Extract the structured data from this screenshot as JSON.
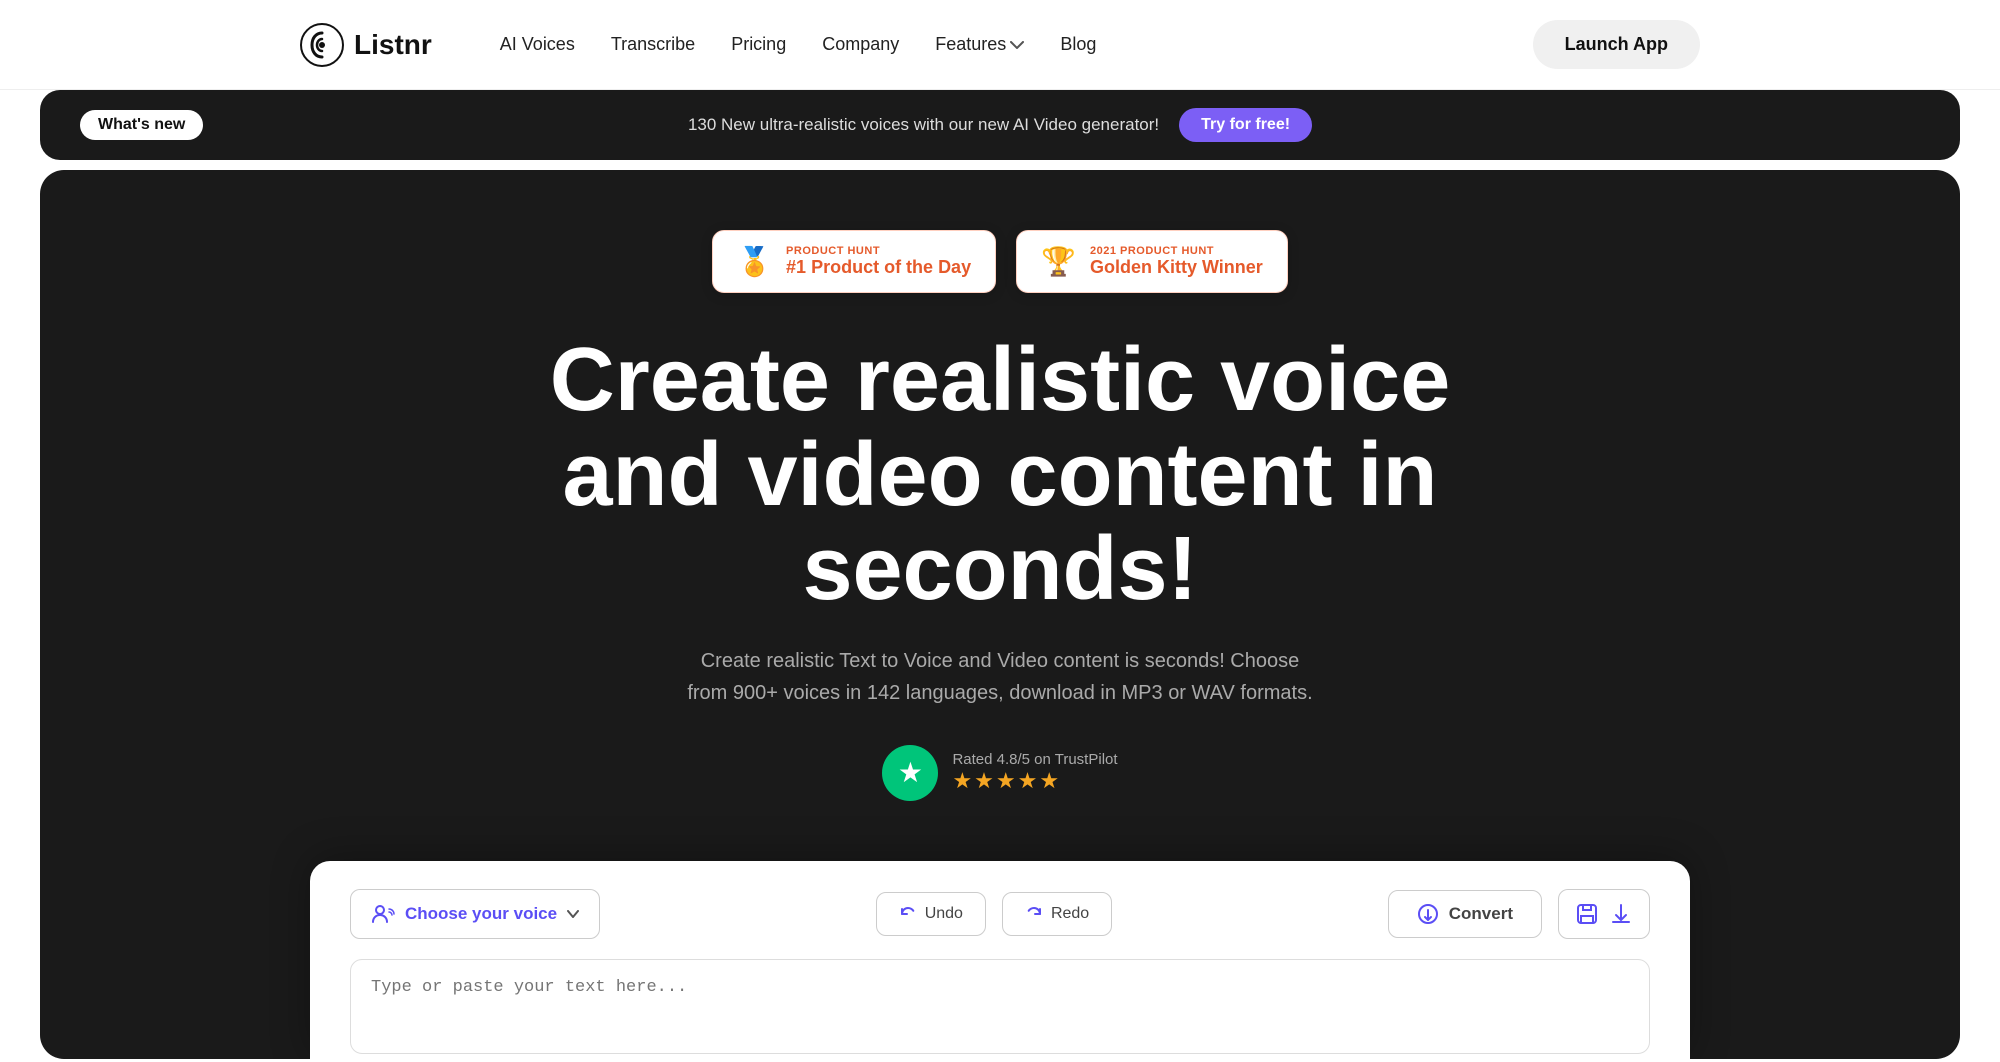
{
  "navbar": {
    "logo_text": "Listnr",
    "links": [
      {
        "label": "AI Voices",
        "id": "ai-voices"
      },
      {
        "label": "Transcribe",
        "id": "transcribe"
      },
      {
        "label": "Pricing",
        "id": "pricing"
      },
      {
        "label": "Company",
        "id": "company"
      },
      {
        "label": "Features",
        "id": "features",
        "has_dropdown": true
      },
      {
        "label": "Blog",
        "id": "blog"
      }
    ],
    "launch_btn": "Launch App"
  },
  "announcement": {
    "badge": "What's new",
    "text": "130 New ultra-realistic voices with our new AI Video generator!",
    "cta": "Try for free!"
  },
  "hero": {
    "badges": [
      {
        "id": "product-hunt",
        "label": "PRODUCT HUNT",
        "title": "#1 Product of the Day",
        "icon": "🏅"
      },
      {
        "id": "golden-kitty",
        "label": "2021 PRODUCT HUNT",
        "title": "Golden Kitty Winner",
        "icon": "🏆"
      }
    ],
    "title": "Create realistic voice and video content in seconds!",
    "subtitle": "Create realistic Text to Voice and Video content is seconds! Choose from 900+ voices in 142 languages, download in MP3 or WAV formats.",
    "trustpilot": {
      "rating": "Rated 4.8/5 on TrustPilot",
      "stars": "★★★★★"
    }
  },
  "editor": {
    "choose_voice_label": "Choose your voice",
    "undo_label": "Undo",
    "redo_label": "Redo",
    "convert_label": "Convert",
    "placeholder": "Type or paste your text here..."
  },
  "colors": {
    "accent": "#5b4ef5",
    "dark_bg": "#1a1a1a",
    "badge_cta": "#7c5ff5",
    "product_hunt_red": "#e55a2b",
    "trustpilot_green": "#00c57a",
    "star_gold": "#f5a623"
  }
}
